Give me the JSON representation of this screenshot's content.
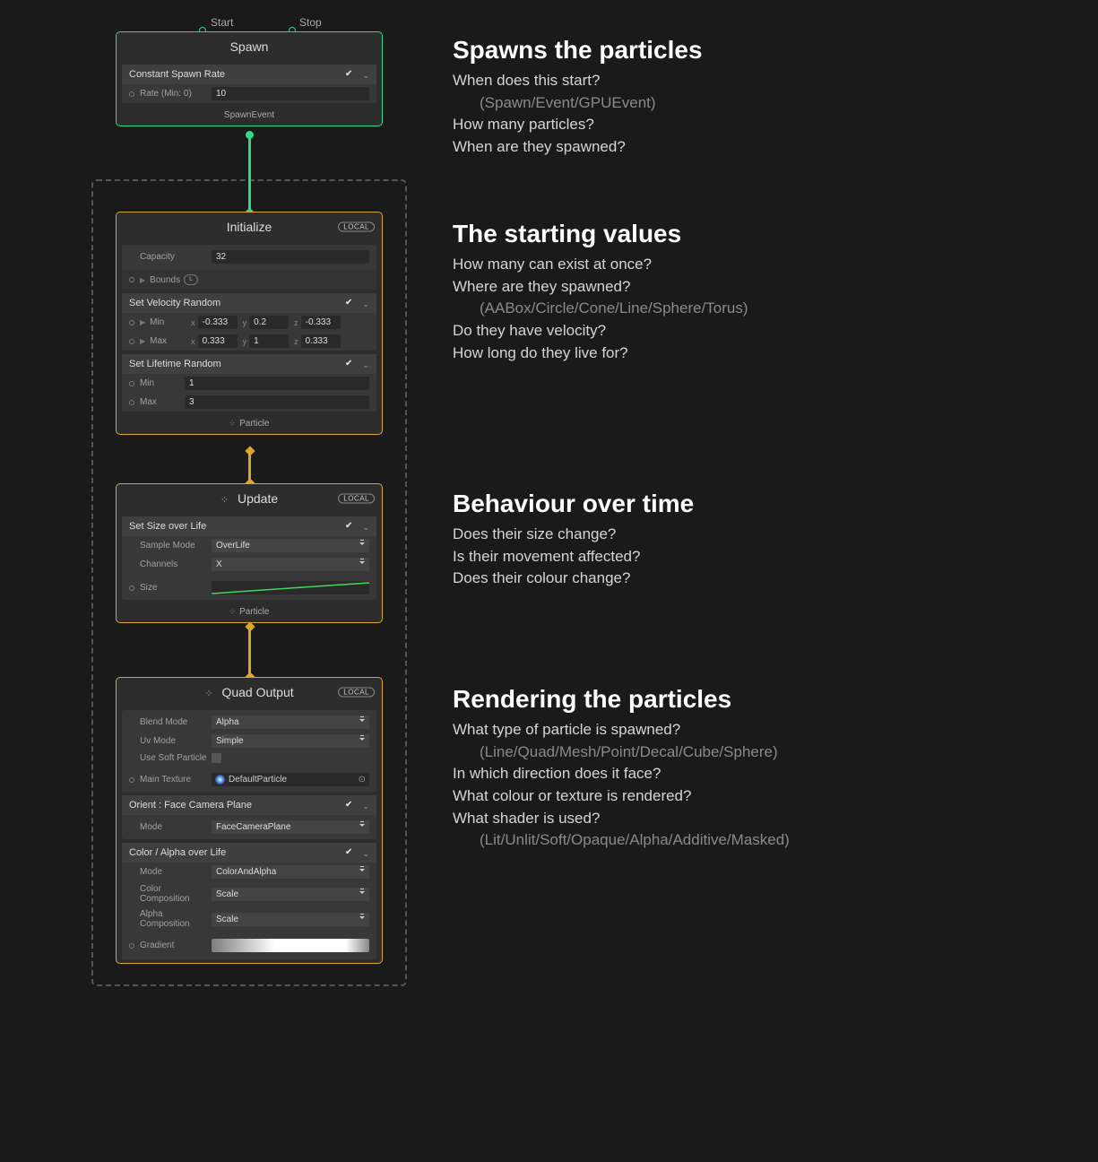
{
  "ports": {
    "start": "Start",
    "stop": "Stop"
  },
  "badges": {
    "local": "LOCAL"
  },
  "spawn": {
    "title": "Spawn",
    "block": "Constant Spawn Rate",
    "rate_label": "Rate (Min: 0)",
    "rate_value": "10",
    "footer": "SpawnEvent"
  },
  "initialize": {
    "title": "Initialize",
    "capacity_label": "Capacity",
    "capacity_value": "32",
    "bounds_label": "Bounds",
    "bounds_pill": "L",
    "vel_block": "Set Velocity Random",
    "min_label": "Min",
    "max_label": "Max",
    "min": {
      "x": "-0.333",
      "y": "0.2",
      "z": "-0.333"
    },
    "max": {
      "x": "0.333",
      "y": "1",
      "z": "0.333"
    },
    "life_block": "Set Lifetime Random",
    "life_min": "1",
    "life_max": "3",
    "footer": "Particle"
  },
  "update": {
    "title": "Update",
    "block": "Set Size over Life",
    "sample_label": "Sample Mode",
    "sample_value": "OverLife",
    "channels_label": "Channels",
    "channels_value": "X",
    "size_label": "Size",
    "footer": "Particle"
  },
  "output": {
    "title": "Quad Output",
    "blend_label": "Blend Mode",
    "blend_value": "Alpha",
    "uv_label": "Uv Mode",
    "uv_value": "Simple",
    "soft_label": "Use Soft Particle",
    "tex_label": "Main Texture",
    "tex_value": "DefaultParticle",
    "orient_block": "Orient : Face Camera Plane",
    "mode_label": "Mode",
    "orient_value": "FaceCameraPlane",
    "color_block": "Color / Alpha over Life",
    "color_mode_value": "ColorAndAlpha",
    "color_comp_label": "Color Composition",
    "color_comp_value": "Scale",
    "alpha_comp_label": "Alpha Composition",
    "alpha_comp_value": "Scale",
    "gradient_label": "Gradient"
  },
  "annot": {
    "spawn": {
      "h": "Spawns the particles",
      "l1": "When does this start?",
      "l2": "(Spawn/Event/GPUEvent)",
      "l3": "How many particles?",
      "l4": "When are they spawned?"
    },
    "init": {
      "h": "The starting values",
      "l1": "How many can exist at once?",
      "l2": "Where are they spawned?",
      "l3": "(AABox/Circle/Cone/Line/Sphere/Torus)",
      "l4": "Do they have velocity?",
      "l5": "How long do they live for?"
    },
    "update": {
      "h": "Behaviour over time",
      "l1": "Does their size change?",
      "l2": "Is their movement affected?",
      "l3": "Does their colour change?"
    },
    "output": {
      "h": "Rendering the particles",
      "l1": "What type of particle is spawned?",
      "l2": "(Line/Quad/Mesh/Point/Decal/Cube/Sphere)",
      "l3": "In which direction does it face?",
      "l4": "What colour or texture is rendered?",
      "l5": "What shader is used?",
      "l6": "(Lit/Unlit/Soft/Opaque/Alpha/Additive/Masked)"
    }
  }
}
